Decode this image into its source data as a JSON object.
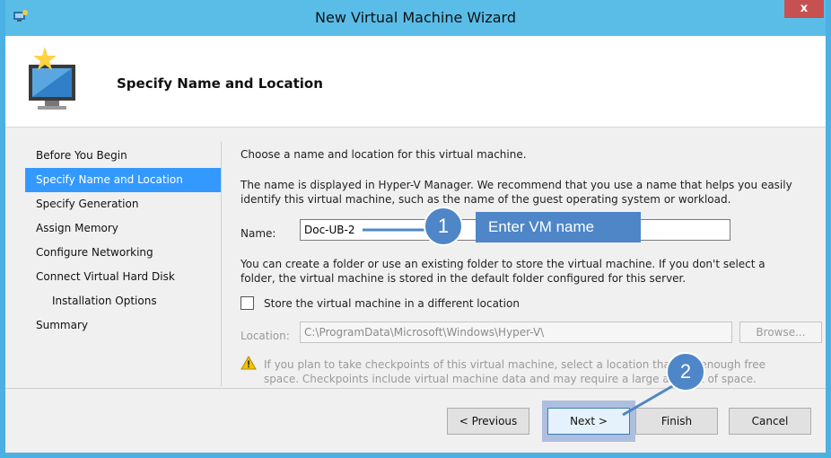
{
  "window": {
    "title": "New Virtual Machine Wizard",
    "close_label": "x"
  },
  "header": {
    "title": "Specify Name and Location"
  },
  "nav": {
    "items": [
      {
        "label": "Before You Begin"
      },
      {
        "label": "Specify Name and Location"
      },
      {
        "label": "Specify Generation"
      },
      {
        "label": "Assign Memory"
      },
      {
        "label": "Configure Networking"
      },
      {
        "label": "Connect Virtual Hard Disk"
      },
      {
        "label": "Installation Options"
      },
      {
        "label": "Summary"
      }
    ],
    "selected": "Specify Name and Location"
  },
  "main": {
    "intro": "Choose a name and location for this virtual machine.",
    "description_line1": "The name is displayed in Hyper-V Manager. We recommend that you use a name that helps you easily",
    "description_line2": "identify this virtual machine, such as the name of the guest operating system or workload.",
    "name_label": "Name:",
    "name_value": "Doc-UB-2",
    "folder_line1": "You can create a folder or use an existing folder to store the virtual machine. If you don't select a",
    "folder_line2": "folder, the virtual machine is stored in the default folder configured for this server.",
    "store_checkbox_label": "Store the virtual machine in a different location",
    "store_checked": false,
    "location_label": "Location:",
    "location_value": "C:\\ProgramData\\Microsoft\\Windows\\Hyper-V\\",
    "browse_label": "Browse...",
    "warning_line1": "If you plan to take checkpoints of this virtual machine, select a location that has enough free",
    "warning_line2": "space. Checkpoints include virtual machine data and may require a large amount of space."
  },
  "footer": {
    "previous_label": "< Previous",
    "next_label": "Next >",
    "finish_label": "Finish",
    "cancel_label": "Cancel"
  },
  "annotations": {
    "badge1": "1",
    "badge1_label": "Enter VM name",
    "badge2": "2"
  },
  "colors": {
    "titlebar": "#59bde8",
    "selection": "#3399ff",
    "callout": "#4e86c8"
  }
}
